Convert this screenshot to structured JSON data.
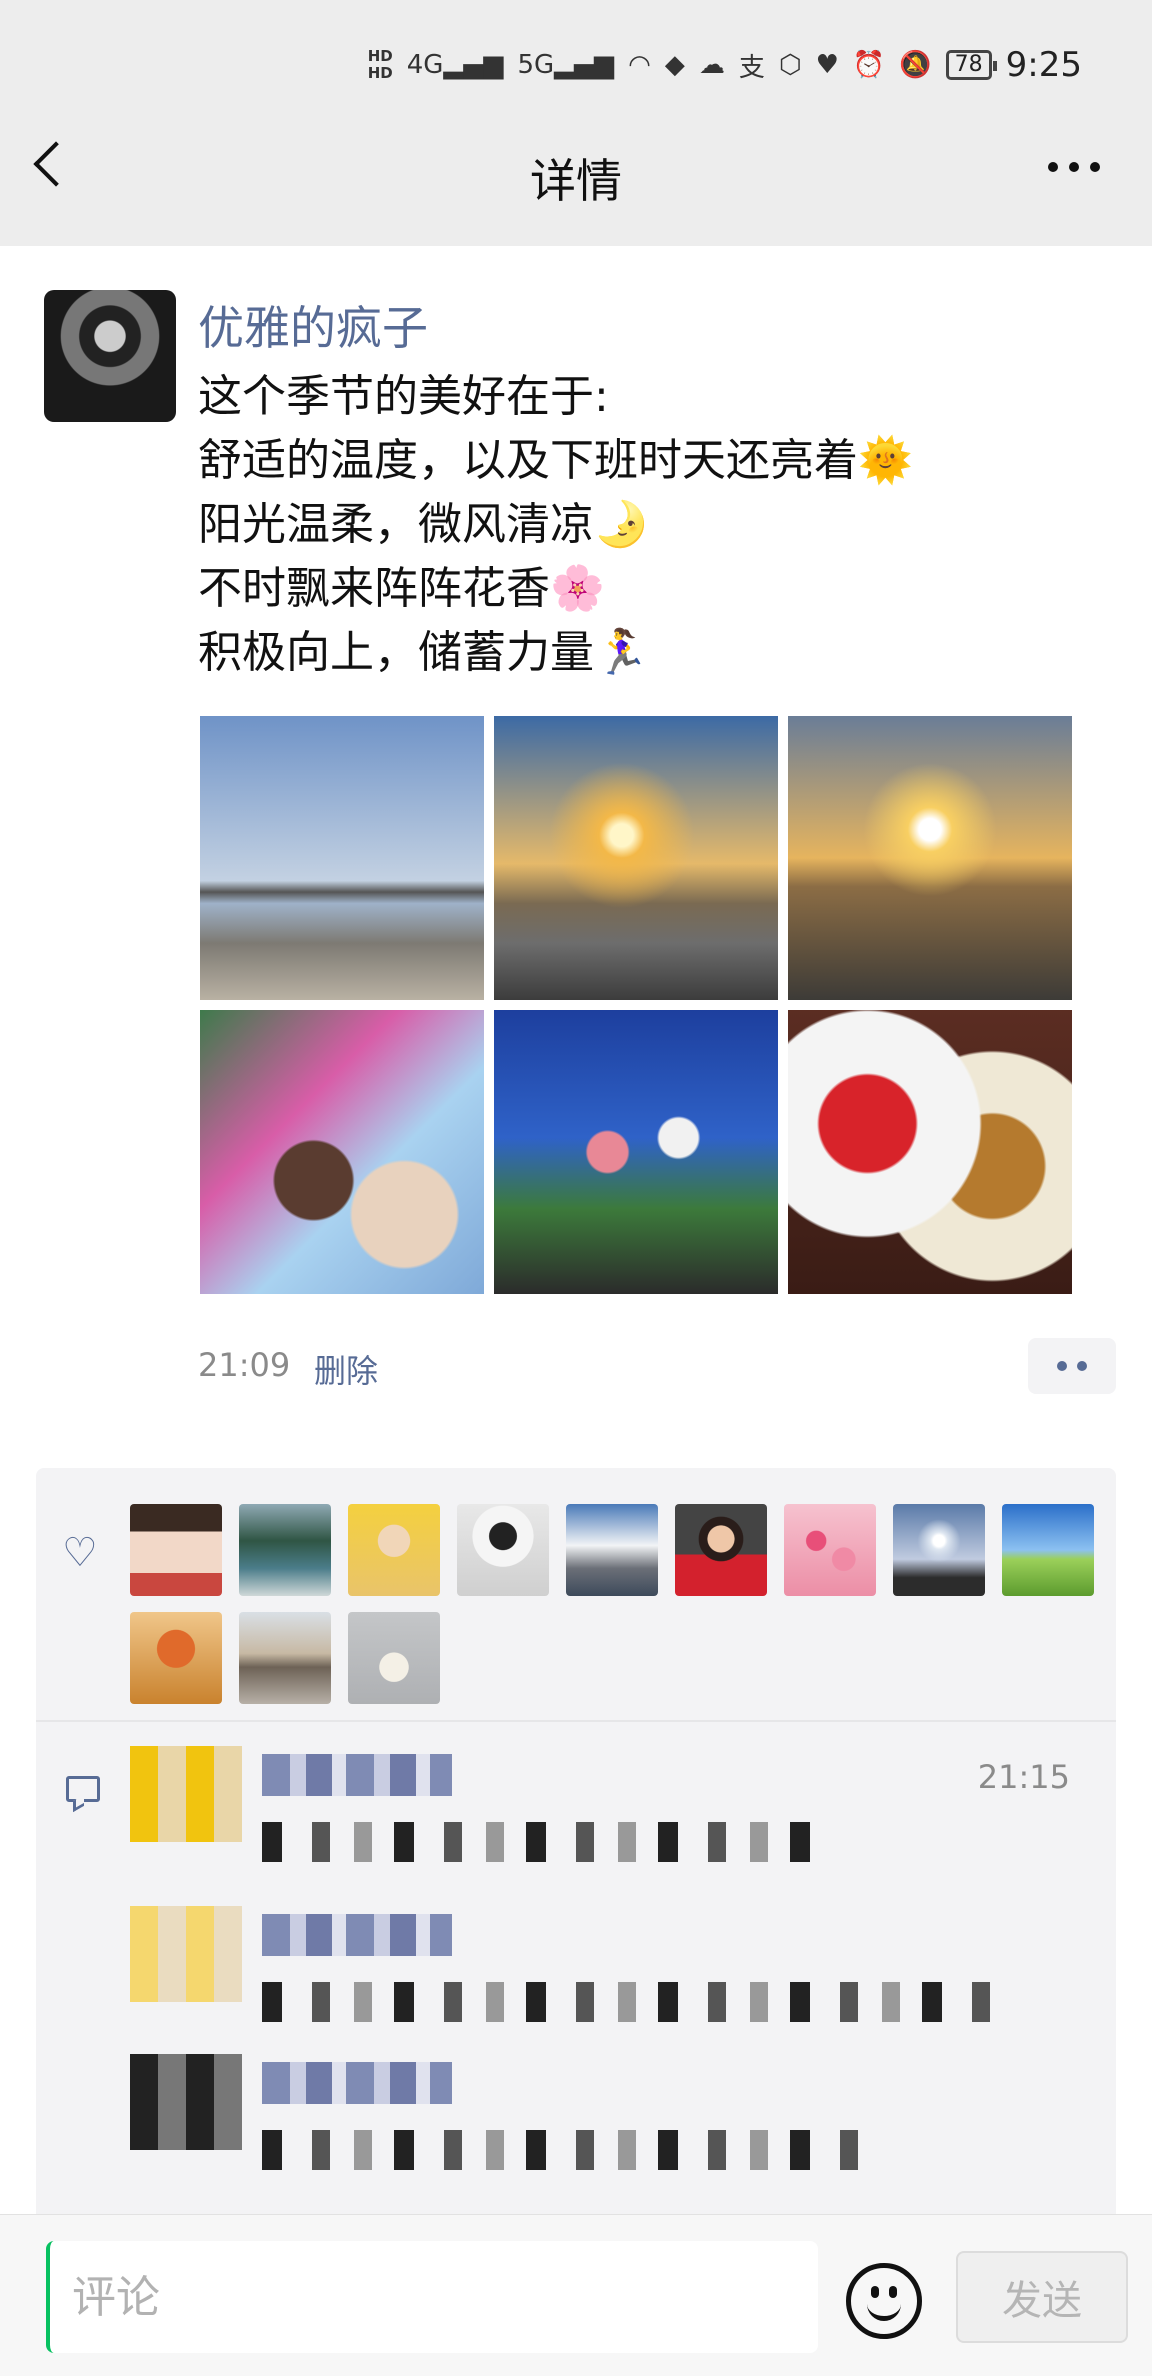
{
  "status_bar": {
    "network1": "4G",
    "network2": "5G",
    "battery": "78",
    "time": "9:25"
  },
  "nav": {
    "title": "详情"
  },
  "post": {
    "author": "优雅的疯子",
    "lines": [
      "这个季节的美好在于:",
      "舒适的温度，以及下班时天还亮着🌞",
      "阳光温柔，微风清凉🌛",
      "不时飘来阵阵花香🌸",
      "积极向上，储蓄力量🏃‍♀️"
    ],
    "time": "21:09",
    "delete_label": "删除"
  },
  "comments": {
    "first_time": "21:15"
  },
  "input": {
    "placeholder": "评论",
    "send_label": "发送"
  },
  "icons": [
    "back-icon",
    "more-icon",
    "heart-icon",
    "comment-icon",
    "emoji-icon"
  ]
}
